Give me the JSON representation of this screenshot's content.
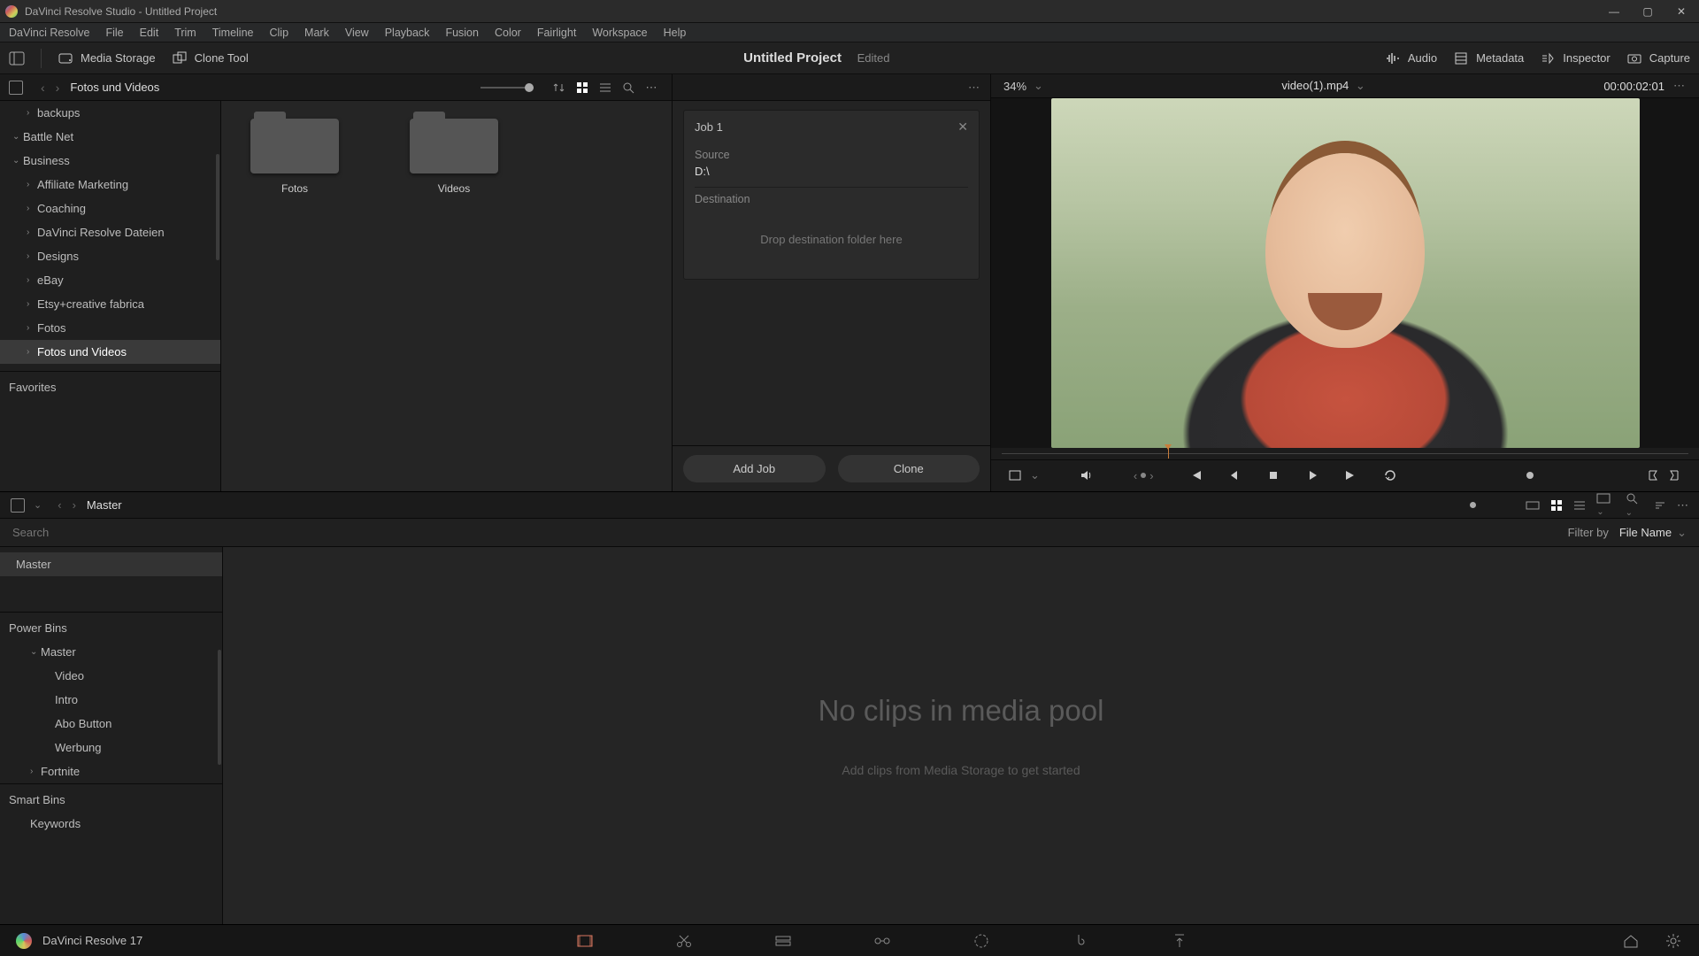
{
  "window": {
    "title": "DaVinci Resolve Studio - Untitled Project"
  },
  "menubar": [
    "DaVinci Resolve",
    "File",
    "Edit",
    "Trim",
    "Timeline",
    "Clip",
    "Mark",
    "View",
    "Playback",
    "Fusion",
    "Color",
    "Fairlight",
    "Workspace",
    "Help"
  ],
  "toolbar": {
    "media_storage": "Media Storage",
    "clone_tool": "Clone Tool",
    "project_name": "Untitled Project",
    "project_status": "Edited",
    "audio": "Audio",
    "metadata": "Metadata",
    "inspector": "Inspector",
    "capture": "Capture"
  },
  "media_browser": {
    "path": "Fotos und Videos",
    "tree": [
      {
        "label": "backups",
        "level": 1,
        "exp": "›"
      },
      {
        "label": "Battle Net",
        "level": 0,
        "exp": "⌄"
      },
      {
        "label": "Business",
        "level": 0,
        "exp": "⌄"
      },
      {
        "label": "Affiliate Marketing",
        "level": 1,
        "exp": "›"
      },
      {
        "label": "Coaching",
        "level": 1,
        "exp": "›"
      },
      {
        "label": "DaVinci Resolve Dateien",
        "level": 1,
        "exp": "›"
      },
      {
        "label": "Designs",
        "level": 1,
        "exp": "›"
      },
      {
        "label": "eBay",
        "level": 1,
        "exp": "›"
      },
      {
        "label": "Etsy+creative fabrica",
        "level": 1,
        "exp": "›"
      },
      {
        "label": "Fotos",
        "level": 1,
        "exp": "›"
      },
      {
        "label": "Fotos und Videos",
        "level": 1,
        "exp": "›",
        "sel": true
      }
    ],
    "favorites_label": "Favorites",
    "folders": [
      {
        "name": "Fotos"
      },
      {
        "name": "Videos"
      }
    ]
  },
  "clone": {
    "job_title": "Job 1",
    "source_label": "Source",
    "source_value": "D:\\",
    "dest_label": "Destination",
    "drop_hint": "Drop destination folder here",
    "add_job": "Add Job",
    "clone_btn": "Clone"
  },
  "viewer": {
    "zoom": "34%",
    "clip_name": "video(1).mp4",
    "timecode": "00:00:02:01"
  },
  "pool": {
    "crumb": "Master",
    "search_placeholder": "Search",
    "filter_by": "Filter by",
    "filter_value": "File Name",
    "master_label": "Master",
    "power_bins_label": "Power Bins",
    "power_bins": [
      {
        "label": "Master",
        "level": 0,
        "exp": "⌄"
      },
      {
        "label": "Video",
        "level": 1
      },
      {
        "label": "Intro",
        "level": 1
      },
      {
        "label": "Abo Button",
        "level": 1
      },
      {
        "label": "Werbung",
        "level": 1
      },
      {
        "label": "Fortnite",
        "level": 0,
        "exp": "›"
      }
    ],
    "smart_bins_label": "Smart Bins",
    "smart_bins": [
      {
        "label": "Keywords"
      }
    ],
    "empty_big": "No clips in media pool",
    "empty_sub": "Add clips from Media Storage to get started"
  },
  "footer": {
    "app": "DaVinci Resolve 17"
  }
}
